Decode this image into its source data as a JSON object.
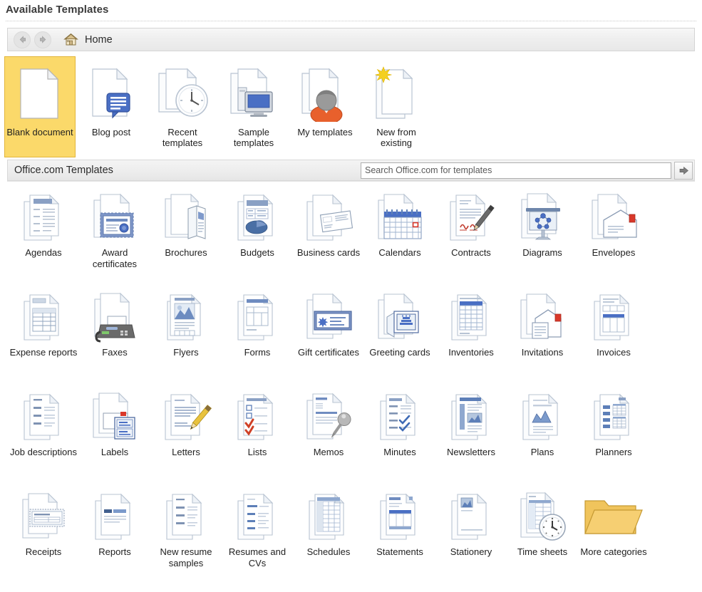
{
  "header": {
    "title": "Available Templates"
  },
  "nav": {
    "back_icon": "arrow-left-icon",
    "forward_icon": "arrow-right-icon",
    "home_icon": "home-icon",
    "breadcrumb": "Home"
  },
  "top_templates": [
    {
      "label": "Blank document",
      "icon": "blank-document-icon",
      "selected": true
    },
    {
      "label": "Blog post",
      "icon": "blog-post-icon",
      "selected": false
    },
    {
      "label": "Recent templates",
      "icon": "recent-templates-icon",
      "selected": false
    },
    {
      "label": "Sample templates",
      "icon": "sample-templates-icon",
      "selected": false
    },
    {
      "label": "My templates",
      "icon": "my-templates-icon",
      "selected": false
    },
    {
      "label": "New from existing",
      "icon": "new-from-existing-icon",
      "selected": false
    }
  ],
  "office_section": {
    "label": "Office.com Templates",
    "search_placeholder": "Search Office.com for templates",
    "search_value": "",
    "go_icon": "arrow-right-icon"
  },
  "categories": [
    {
      "label": "Agendas",
      "icon": "agendas-icon"
    },
    {
      "label": "Award certificates",
      "icon": "award-certificates-icon"
    },
    {
      "label": "Brochures",
      "icon": "brochures-icon"
    },
    {
      "label": "Budgets",
      "icon": "budgets-icon"
    },
    {
      "label": "Business cards",
      "icon": "business-cards-icon"
    },
    {
      "label": "Calendars",
      "icon": "calendars-icon"
    },
    {
      "label": "Contracts",
      "icon": "contracts-icon"
    },
    {
      "label": "Diagrams",
      "icon": "diagrams-icon"
    },
    {
      "label": "Envelopes",
      "icon": "envelopes-icon"
    },
    {
      "label": "Expense reports",
      "icon": "expense-reports-icon"
    },
    {
      "label": "Faxes",
      "icon": "faxes-icon"
    },
    {
      "label": "Flyers",
      "icon": "flyers-icon"
    },
    {
      "label": "Forms",
      "icon": "forms-icon"
    },
    {
      "label": "Gift certificates",
      "icon": "gift-certificates-icon"
    },
    {
      "label": "Greeting cards",
      "icon": "greeting-cards-icon"
    },
    {
      "label": "Inventories",
      "icon": "inventories-icon"
    },
    {
      "label": "Invitations",
      "icon": "invitations-icon"
    },
    {
      "label": "Invoices",
      "icon": "invoices-icon"
    },
    {
      "label": "Job descriptions",
      "icon": "job-descriptions-icon"
    },
    {
      "label": "Labels",
      "icon": "labels-icon"
    },
    {
      "label": "Letters",
      "icon": "letters-icon"
    },
    {
      "label": "Lists",
      "icon": "lists-icon"
    },
    {
      "label": "Memos",
      "icon": "memos-icon"
    },
    {
      "label": "Minutes",
      "icon": "minutes-icon"
    },
    {
      "label": "Newsletters",
      "icon": "newsletters-icon"
    },
    {
      "label": "Plans",
      "icon": "plans-icon"
    },
    {
      "label": "Planners",
      "icon": "planners-icon"
    },
    {
      "label": "Receipts",
      "icon": "receipts-icon"
    },
    {
      "label": "Reports",
      "icon": "reports-icon"
    },
    {
      "label": "New resume samples",
      "icon": "new-resume-samples-icon"
    },
    {
      "label": "Resumes and CVs",
      "icon": "resumes-and-cvs-icon"
    },
    {
      "label": "Schedules",
      "icon": "schedules-icon"
    },
    {
      "label": "Statements",
      "icon": "statements-icon"
    },
    {
      "label": "Stationery",
      "icon": "stationery-icon"
    },
    {
      "label": "Time sheets",
      "icon": "time-sheets-icon"
    },
    {
      "label": "More categories",
      "icon": "more-categories-folder-icon"
    }
  ],
  "colors": {
    "selection_fill": "#fbd96a",
    "selection_border": "#e2b53c",
    "doc_outline": "#b9c4d2",
    "accent_blue": "#4a6fa5",
    "accent_blue_light": "#aebfd8",
    "folder_yellow": "#f0b84a",
    "red_stamp": "#d03a2a"
  }
}
